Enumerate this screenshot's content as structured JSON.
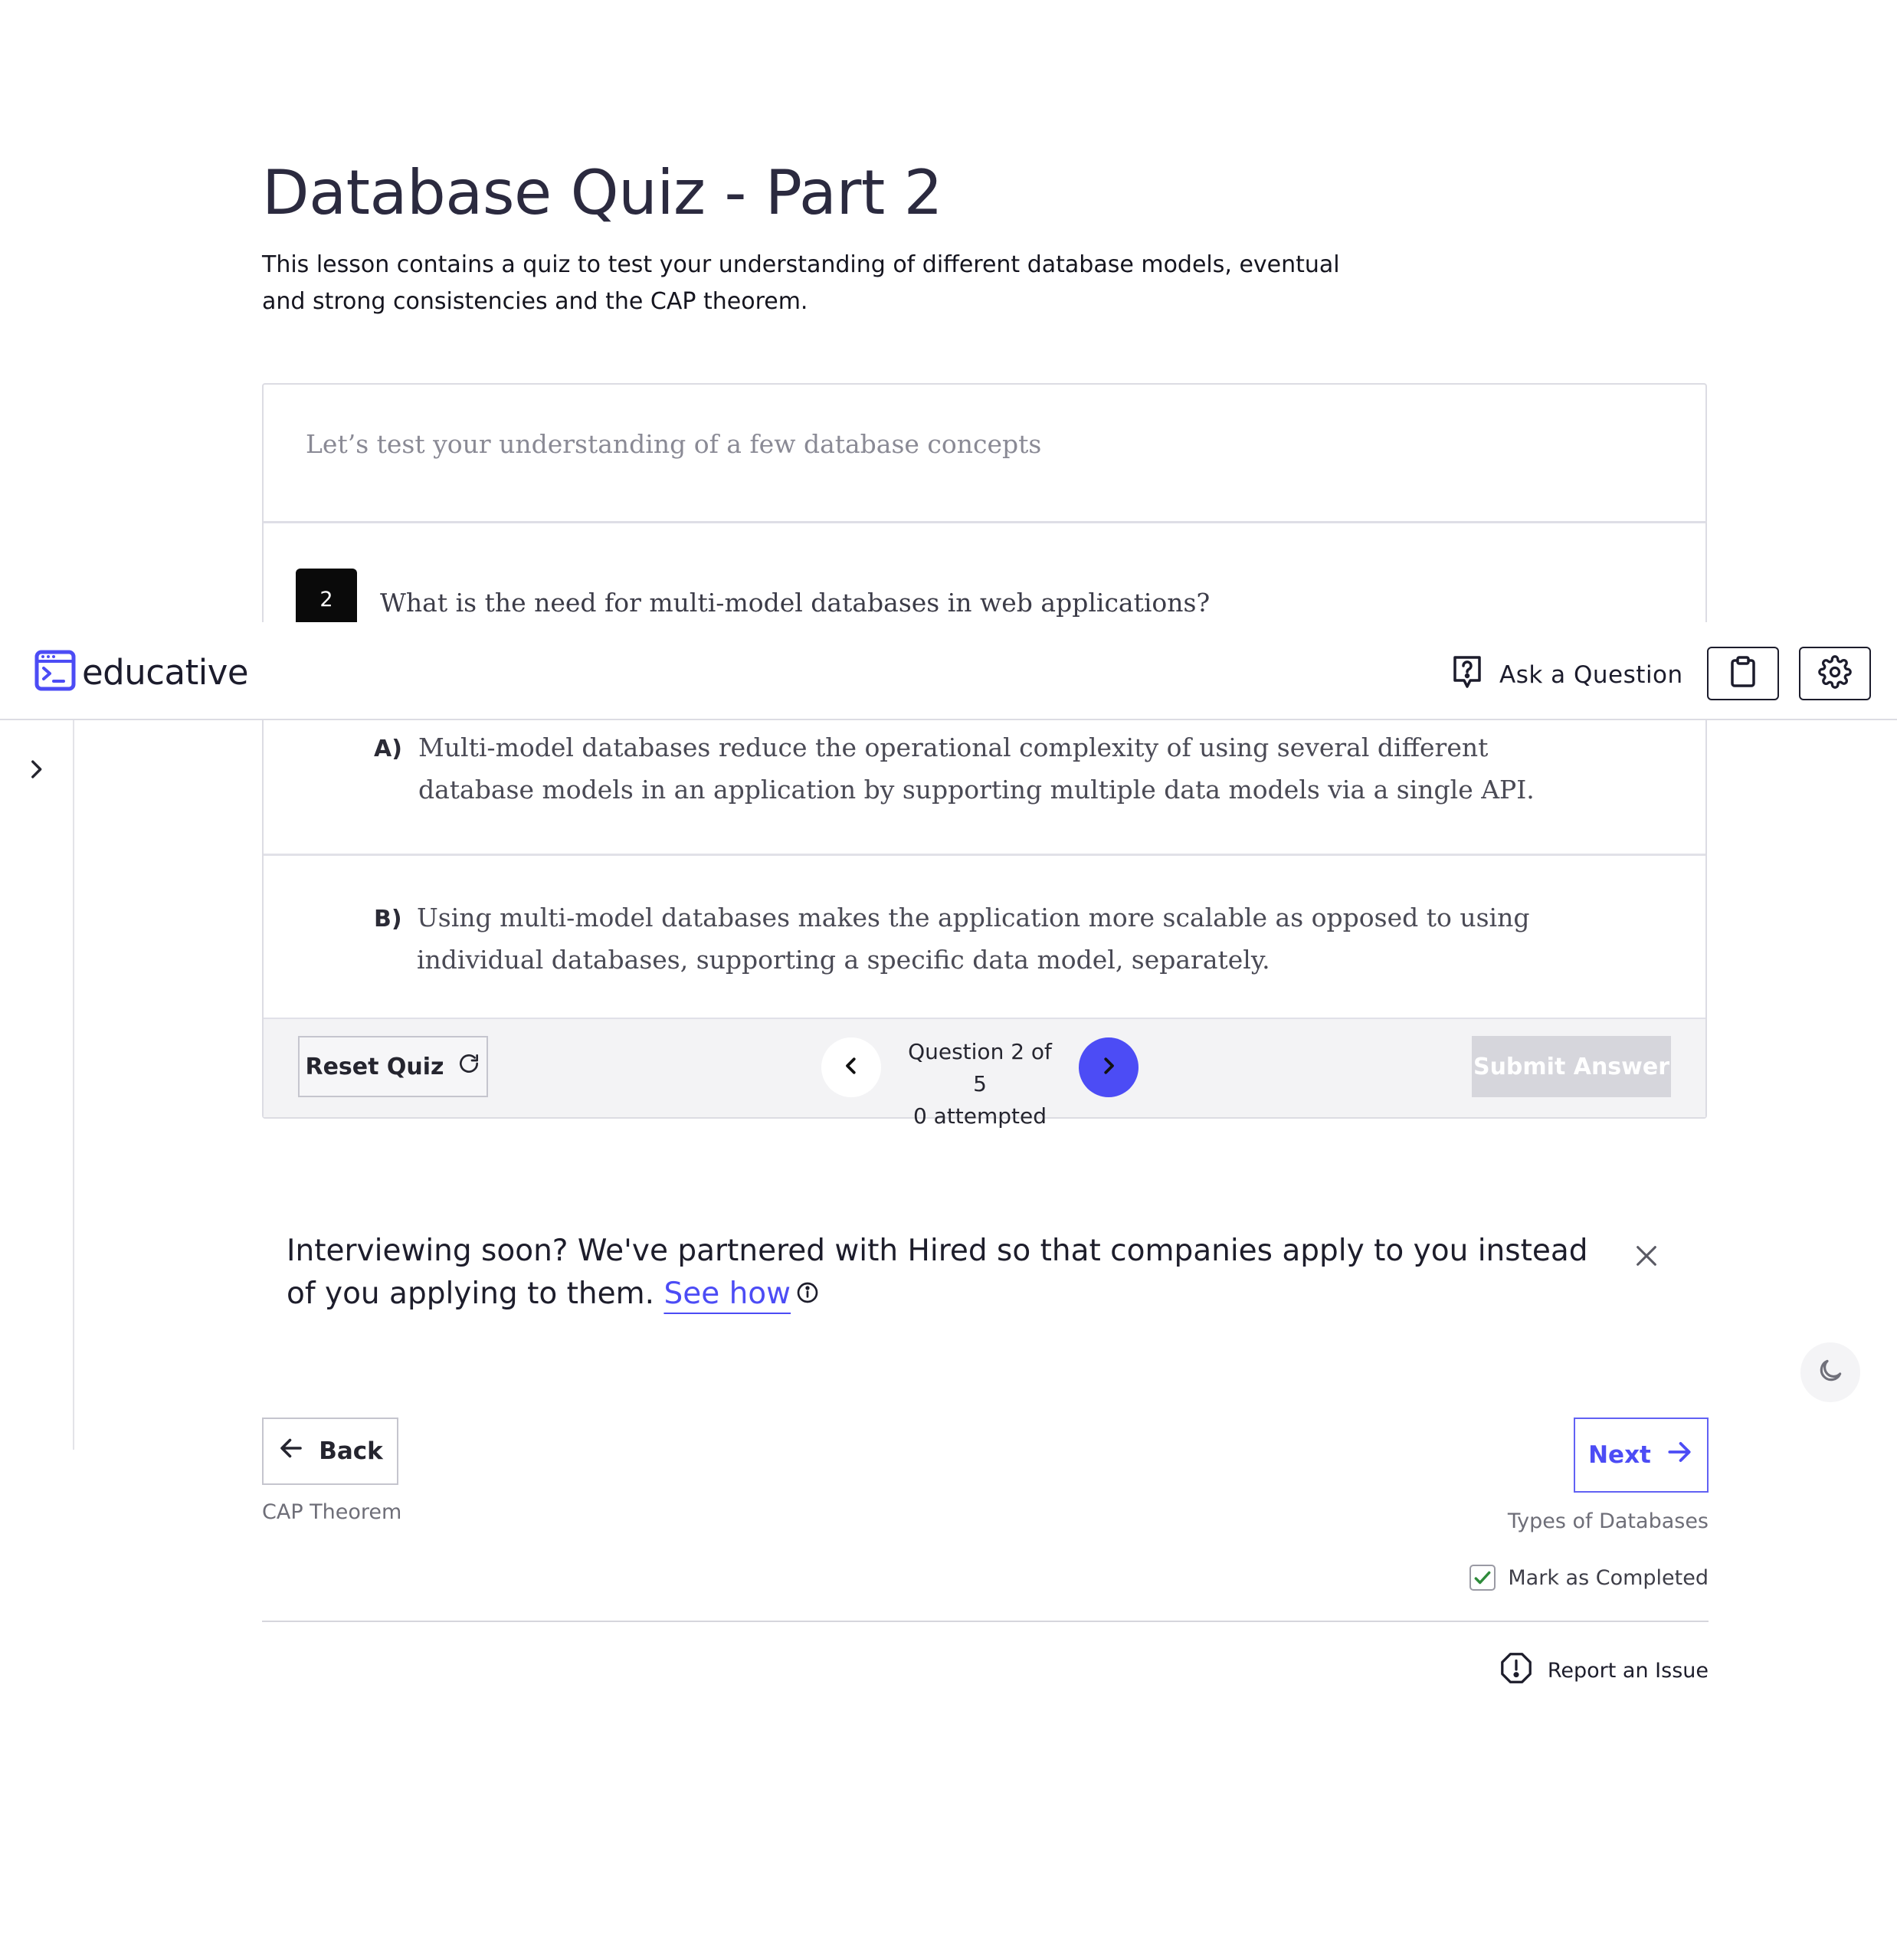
{
  "lesson": {
    "title": "Database Quiz - Part 2",
    "description": "This lesson contains a quiz to test your understanding of different database models, eventual and strong consistencies and the CAP theorem."
  },
  "quiz": {
    "intro": "Let’s test your understanding of a few database concepts",
    "question_number": "2",
    "question": "What is the need for multi-model databases in web applications?",
    "options": [
      {
        "letter": "A)",
        "text": "Multi-model databases reduce the operational complexity of using several different database models in an application by supporting multiple data models via a single API."
      },
      {
        "letter": "B)",
        "text": "Using multi-model databases makes the application more scalable as opposed to using individual databases, supporting a specific data model, separately."
      }
    ],
    "reset_label": "Reset Quiz",
    "progress": "Question 2 of 5",
    "attempted": "0 attempted",
    "submit_label": "Submit Answer"
  },
  "header": {
    "logo_text": "educative",
    "ask_label": "Ask a Question"
  },
  "promo": {
    "text": "Interviewing soon? We've partnered with Hired so that companies apply to you instead of you applying to them.",
    "link": "See how"
  },
  "navigation": {
    "back_label": "Back",
    "back_target": "CAP Theorem",
    "next_label": "Next",
    "next_target": "Types of Databases",
    "mark_completed": "Mark as Completed",
    "report_issue": "Report an Issue"
  },
  "colors": {
    "accent": "#4c4cf5",
    "check": "#2e8b3a",
    "text_dark": "#1f1f33"
  },
  "icons": [
    "ask-question-icon",
    "clipboard-icon",
    "gear-icon",
    "refresh-icon",
    "chevron-left-icon",
    "chevron-right-icon",
    "close-icon",
    "info-icon",
    "moon-icon",
    "arrow-left-icon",
    "arrow-right-icon",
    "checkmark-icon",
    "alert-icon"
  ]
}
